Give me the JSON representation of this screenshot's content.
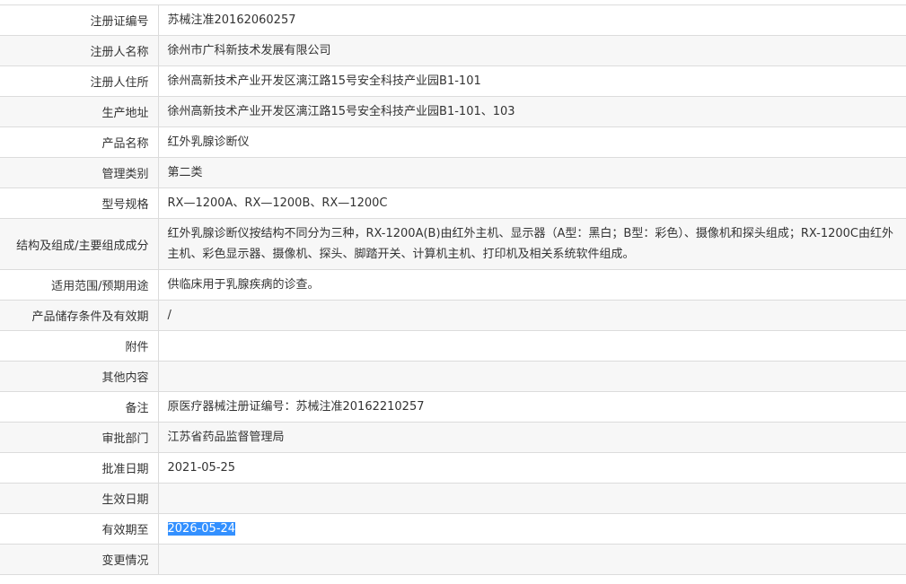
{
  "rows": [
    {
      "label": "注册证编号",
      "value": "苏械注准20162060257"
    },
    {
      "label": "注册人名称",
      "value": "徐州市广科新技术发展有限公司"
    },
    {
      "label": "注册人住所",
      "value": "徐州高新技术产业开发区漓江路15号安全科技产业园B1-101"
    },
    {
      "label": "生产地址",
      "value": "徐州高新技术产业开发区漓江路15号安全科技产业园B1-101、103"
    },
    {
      "label": "产品名称",
      "value": "红外乳腺诊断仪"
    },
    {
      "label": "管理类别",
      "value": "第二类"
    },
    {
      "label": "型号规格",
      "value": "RX—1200A、RX—1200B、RX—1200C"
    },
    {
      "label": "结构及组成/主要组成成分",
      "value": "红外乳腺诊断仪按结构不同分为三种，RX-1200A(B)由红外主机、显示器（A型：黑白；B型：彩色）、摄像机和探头组成；RX-1200C由红外主机、彩色显示器、摄像机、探头、脚踏开关、计算机主机、打印机及相关系统软件组成。"
    },
    {
      "label": "适用范围/预期用途",
      "value": "供临床用于乳腺疾病的诊查。"
    },
    {
      "label": "产品储存条件及有效期",
      "value": "/"
    },
    {
      "label": "附件",
      "value": ""
    },
    {
      "label": "其他内容",
      "value": ""
    },
    {
      "label": "备注",
      "value": "原医疗器械注册证编号：苏械注准20162210257"
    },
    {
      "label": "审批部门",
      "value": "江苏省药品监督管理局"
    },
    {
      "label": "批准日期",
      "value": "2021-05-25"
    },
    {
      "label": "生效日期",
      "value": ""
    },
    {
      "label": "有效期至",
      "value": "2026-05-24"
    },
    {
      "label": "变更情况",
      "value": ""
    }
  ],
  "colors": {
    "border": "#dcdcdc",
    "stripe": "#f7f7f7",
    "selection": "#3390ff",
    "text": "#333333"
  }
}
